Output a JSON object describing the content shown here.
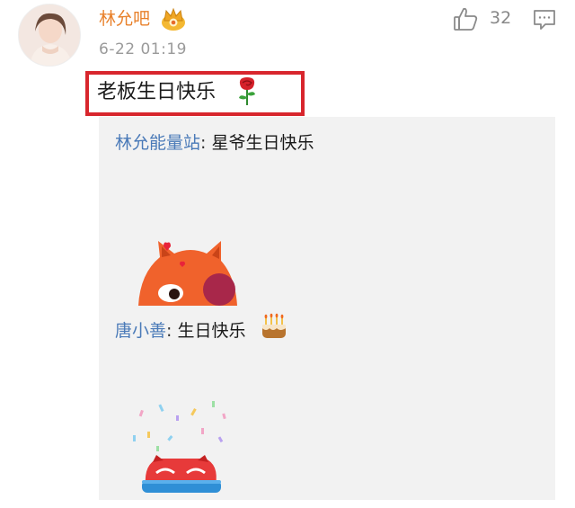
{
  "comment": {
    "username": "林允吧",
    "timestamp": "6-22 01:19",
    "text": "老板生日快乐",
    "like_count": "32"
  },
  "replies": [
    {
      "user": "林允能量站",
      "separator": ": ",
      "text": "星爷生日快乐"
    },
    {
      "user": "唐小善",
      "separator": ": ",
      "text": "生日快乐"
    }
  ],
  "icons": {
    "vip": "crown-badge-icon",
    "like": "thumbs-up-icon",
    "comment": "comment-bubble-icon",
    "rose": "rose-emoji-icon",
    "cake": "birthday-cake-emoji-icon"
  },
  "colors": {
    "username": "#e8802a",
    "reply_user": "#4a7ab8",
    "highlight": "#d8262d",
    "panel": "#f2f2f2"
  }
}
